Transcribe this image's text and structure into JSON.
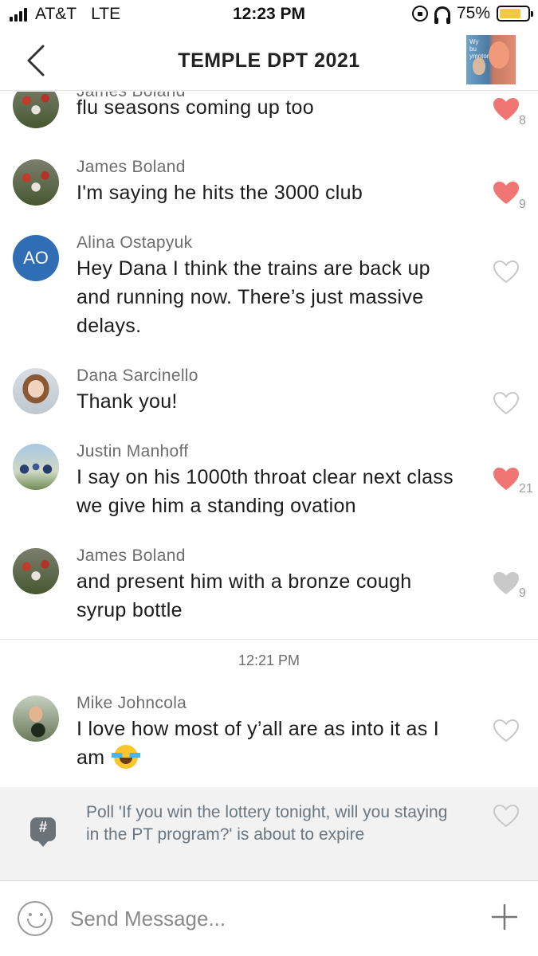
{
  "status_bar": {
    "carrier": "AT&T",
    "network": "LTE",
    "time": "12:23 PM",
    "battery": "75%",
    "battery_level": 0.75,
    "icons": [
      "signal-icon",
      "rotation-lock-icon",
      "headphones-icon",
      "battery-icon"
    ]
  },
  "nav": {
    "back_icon": "chevron-left-icon",
    "title": "TEMPLE DPT 2021",
    "group_avatar_text": "Wy\nbu\nymotor"
  },
  "messages": [
    {
      "author": "James Boland",
      "text": "flu seasons coming up too",
      "liked": true,
      "heart_color": "#f07673",
      "likes": "8"
    },
    {
      "author": "James Boland",
      "text": "I'm saying he hits the 3000 club",
      "liked": true,
      "heart_color": "#f07673",
      "likes": "9"
    },
    {
      "author": "Alina Ostapyuk",
      "initials": "AO",
      "text": "Hey Dana I think the trains are back up and running now. There’s just massive delays.",
      "liked": false,
      "likes": ""
    },
    {
      "author": "Dana Sarcinello",
      "text": "Thank you!",
      "liked": false,
      "likes": ""
    },
    {
      "author": "Justin Manhoff",
      "text": "I say on his 1000th throat clear next class we give him a standing ovation",
      "liked": true,
      "heart_color": "#f07673",
      "likes": "21"
    },
    {
      "author": "James Boland",
      "text": "and present him with a bronze cough syrup bottle",
      "liked": true,
      "heart_color": "#c9c9c9",
      "likes": "9"
    },
    {
      "author": "Mike Johncola",
      "text": "I love how most of y’all are as into it as I am",
      "emoji": "face-with-tears-of-joy",
      "liked": false,
      "likes": ""
    }
  ],
  "timestamp_divider": "12:21 PM",
  "poll_notice": {
    "icon": "groupme-hashtag-icon",
    "text": "Poll 'If you win the lottery tonight, will you staying in the PT program?' is about to expire"
  },
  "composer": {
    "placeholder": "Send Message...",
    "emoji_icon": "smiley-icon",
    "add_icon": "plus-icon"
  },
  "colors": {
    "heart_liked": "#f07673",
    "heart_gray": "#c9c9c9",
    "avatar_initials_bg": "#2f6db5",
    "battery": "#f5c842"
  }
}
